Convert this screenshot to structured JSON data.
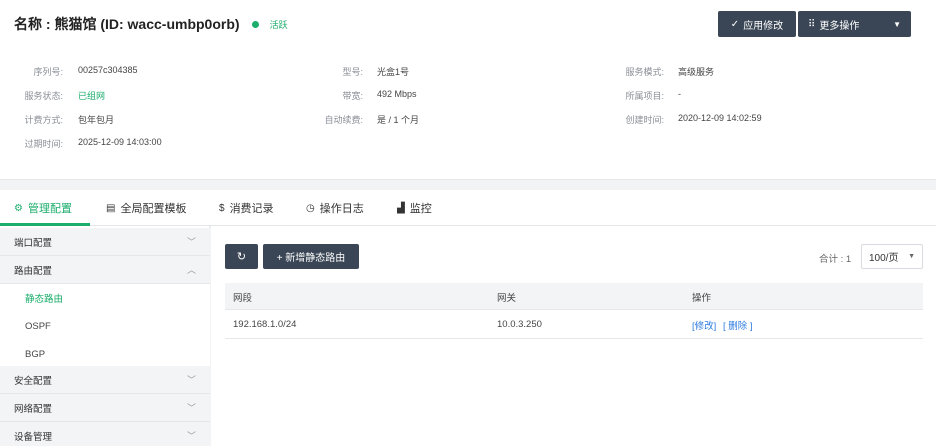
{
  "header": {
    "title": "名称 : 熊猫馆 (ID: wacc-umbp0orb)",
    "status": "活跃",
    "status_color": "#1aad6b",
    "apply_button": "应用修改",
    "more_button": "更多操作"
  },
  "info": {
    "serial_label": "序列号:",
    "serial_value": "00257c304385",
    "service_status_label": "服务状态:",
    "service_status_value": "已组网",
    "billing_label": "计费方式:",
    "billing_value": "包年包月",
    "expire_label": "过期时间:",
    "expire_value": "2025-12-09 14:03:00",
    "model_label": "型号:",
    "model_value": "光盒1号",
    "bandwidth_label": "带宽:",
    "bandwidth_value": "492 Mbps",
    "renew_label": "自动续费:",
    "renew_value": "是 / 1 个月",
    "mode_label": "服务模式:",
    "mode_value": "高级服务",
    "project_label": "所属项目:",
    "project_value": "-",
    "created_label": "创建时间:",
    "created_value": "2020-12-09 14:02:59"
  },
  "tabs": [
    {
      "label": "管理配置",
      "icon": "settings-icon"
    },
    {
      "label": "全局配置模板",
      "icon": "document-icon"
    },
    {
      "label": "消费记录",
      "icon": "dollar-icon"
    },
    {
      "label": "操作日志",
      "icon": "clock-icon"
    },
    {
      "label": "监控",
      "icon": "chart-icon"
    }
  ],
  "sidebar": {
    "port_config": "端口配置",
    "route_config": "路由配置",
    "static_route": "静态路由",
    "ospf": "OSPF",
    "bgp": "BGP",
    "security_config": "安全配置",
    "network_config": "网络配置",
    "device_mgmt": "设备管理"
  },
  "toolbar": {
    "add_label": "+ 新增静态路由",
    "total": "合计 : 1",
    "page_size": "100/页"
  },
  "table": {
    "headers": [
      "网段",
      "网关",
      "操作"
    ],
    "rows": [
      {
        "segment": "192.168.1.0/24",
        "gateway": "10.0.3.250",
        "edit": "[修改]",
        "delete": "[ 删除 ]"
      }
    ]
  }
}
